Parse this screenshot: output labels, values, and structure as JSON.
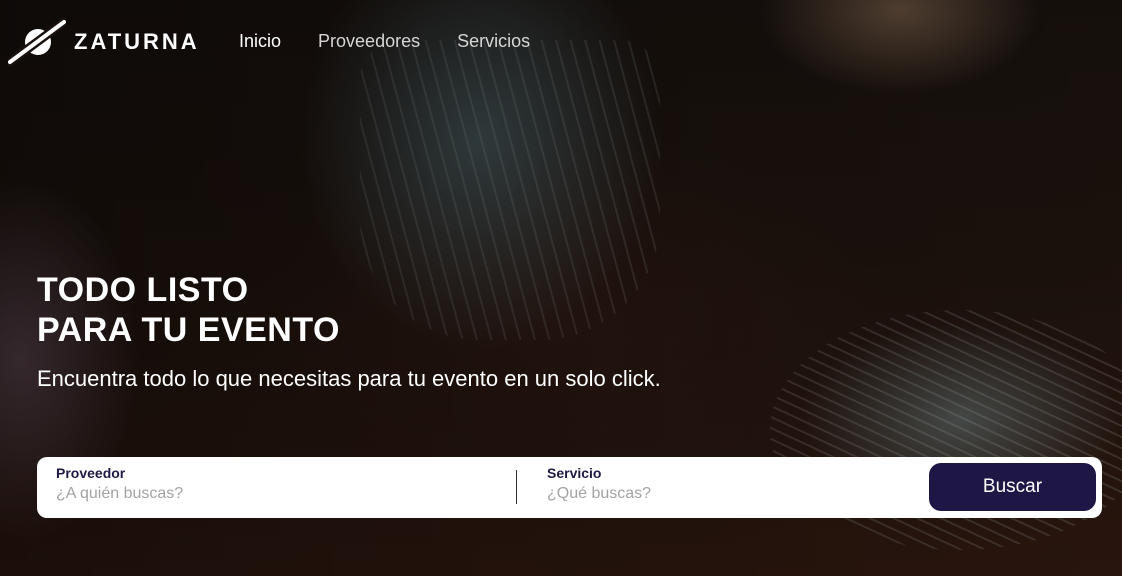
{
  "brand": {
    "name": "ZATURNA",
    "logo_icon": "saturn-logo-icon"
  },
  "nav": {
    "items": [
      {
        "label": "Inicio",
        "active": true
      },
      {
        "label": "Proveedores",
        "active": false
      },
      {
        "label": "Servicios",
        "active": false
      }
    ]
  },
  "hero": {
    "headline_line1": "TODO LISTO",
    "headline_line2": "PARA TU EVENTO",
    "tagline": "Encuentra todo lo que necesitas para tu evento en un solo click."
  },
  "search": {
    "provider_label": "Proveedor",
    "provider_placeholder": "¿A quién buscas?",
    "provider_value": "",
    "service_label": "Servicio",
    "service_placeholder": "¿Qué buscas?",
    "service_value": "",
    "button_label": "Buscar"
  },
  "colors": {
    "accent": "#1e1645",
    "label": "#1f1a44",
    "background": "#1c120d"
  }
}
